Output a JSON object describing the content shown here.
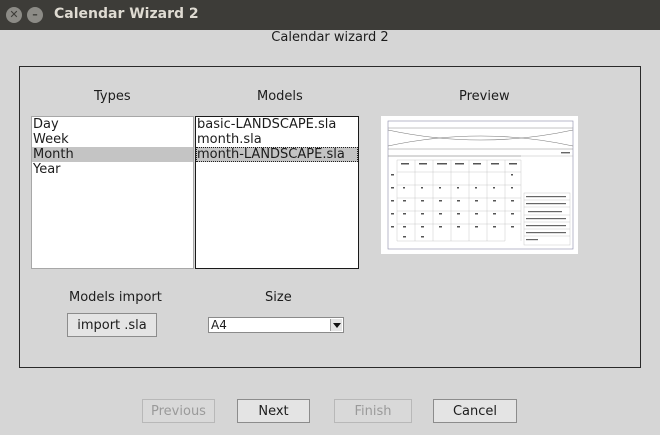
{
  "window": {
    "title": "Calendar Wizard 2"
  },
  "heading": "Calendar wizard 2",
  "types": {
    "label": "Types",
    "items": [
      "Day",
      "Week",
      "Month",
      "Year"
    ],
    "selected": "Month"
  },
  "models": {
    "label": "Models",
    "items": [
      "basic-LANDSCAPE.sla",
      "month.sla",
      "month-LANDSCAPE.sla"
    ],
    "selected": "month-LANDSCAPE.sla"
  },
  "preview": {
    "label": "Preview"
  },
  "models_import": {
    "label": "Models import",
    "button": "import .sla"
  },
  "size": {
    "label": "Size",
    "value": "A4"
  },
  "footer": {
    "previous": "Previous",
    "next": "Next",
    "finish": "Finish",
    "cancel": "Cancel"
  }
}
